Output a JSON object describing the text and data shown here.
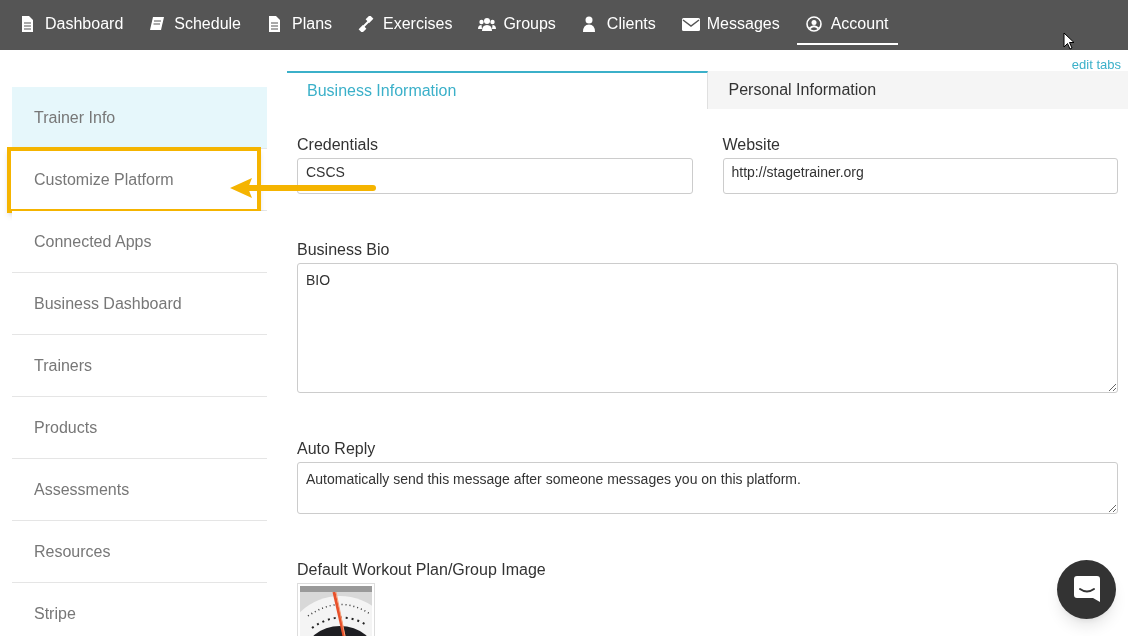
{
  "nav": [
    {
      "label": "Dashboard",
      "selected": false
    },
    {
      "label": "Schedule",
      "selected": false
    },
    {
      "label": "Plans",
      "selected": false
    },
    {
      "label": "Exercises",
      "selected": false
    },
    {
      "label": "Groups",
      "selected": false
    },
    {
      "label": "Clients",
      "selected": false
    },
    {
      "label": "Messages",
      "selected": false
    },
    {
      "label": "Account",
      "selected": true
    }
  ],
  "edit_tabs_link": "edit tabs",
  "sidebar": {
    "items": [
      {
        "label": "Trainer Info",
        "selected": true,
        "highlighted": false
      },
      {
        "label": "Customize Platform",
        "selected": false,
        "highlighted": true
      },
      {
        "label": "Connected Apps",
        "selected": false,
        "highlighted": false
      },
      {
        "label": "Business Dashboard",
        "selected": false,
        "highlighted": false
      },
      {
        "label": "Trainers",
        "selected": false,
        "highlighted": false
      },
      {
        "label": "Products",
        "selected": false,
        "highlighted": false
      },
      {
        "label": "Assessments",
        "selected": false,
        "highlighted": false
      },
      {
        "label": "Resources",
        "selected": false,
        "highlighted": false
      },
      {
        "label": "Stripe",
        "selected": false,
        "highlighted": false
      }
    ]
  },
  "tabs": [
    {
      "label": "Business Information",
      "selected": true
    },
    {
      "label": "Personal Information",
      "selected": false
    }
  ],
  "form": {
    "credentials": {
      "label": "Credentials",
      "value": "CSCS"
    },
    "website": {
      "label": "Website",
      "value": "http://stagetrainer.org"
    },
    "bio": {
      "label": "Business Bio",
      "value": "BIO"
    },
    "auto_reply": {
      "label": "Auto Reply",
      "value": "Automatically send this message after someone messages you on this platform."
    },
    "default_image": {
      "label": "Default Workout Plan/Group Image",
      "kind": "picture"
    }
  }
}
